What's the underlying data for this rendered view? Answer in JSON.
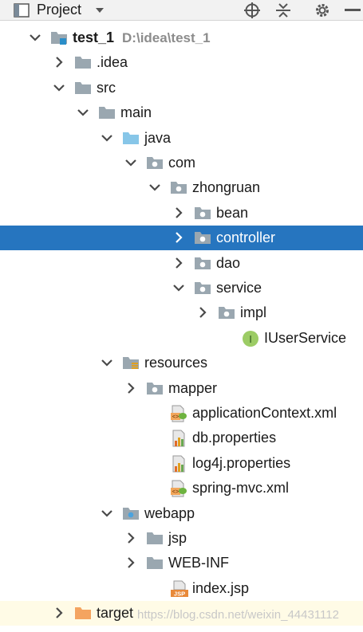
{
  "toolbar": {
    "title": "Project",
    "icons": [
      "project-view-icon",
      "chevron-down-icon",
      "locate-icon",
      "collapse-all-icon",
      "gear-icon",
      "hide-icon"
    ]
  },
  "tree": [
    {
      "id": "test_1",
      "label": "test_1",
      "hint": "D:\\idea\\test_1",
      "level": 0,
      "expanded": true,
      "icon": "module",
      "bold": true
    },
    {
      "id": "idea",
      "label": ".idea",
      "level": 1,
      "expanded": false,
      "icon": "folder"
    },
    {
      "id": "src",
      "label": "src",
      "level": 1,
      "expanded": true,
      "icon": "folder"
    },
    {
      "id": "main",
      "label": "main",
      "level": 2,
      "expanded": true,
      "icon": "folder"
    },
    {
      "id": "java",
      "label": "java",
      "level": 3,
      "expanded": true,
      "icon": "source-root"
    },
    {
      "id": "com",
      "label": "com",
      "level": 4,
      "expanded": true,
      "icon": "package"
    },
    {
      "id": "zhongruan",
      "label": "zhongruan",
      "level": 5,
      "expanded": true,
      "icon": "package"
    },
    {
      "id": "bean",
      "label": "bean",
      "level": 6,
      "expanded": false,
      "icon": "package"
    },
    {
      "id": "controller",
      "label": "controller",
      "level": 6,
      "expanded": false,
      "icon": "package",
      "selected": true
    },
    {
      "id": "dao",
      "label": "dao",
      "level": 6,
      "expanded": false,
      "icon": "package"
    },
    {
      "id": "service",
      "label": "service",
      "level": 6,
      "expanded": true,
      "icon": "package"
    },
    {
      "id": "impl",
      "label": "impl",
      "level": 7,
      "expanded": false,
      "icon": "package"
    },
    {
      "id": "IUserService",
      "label": "IUserService",
      "level": 8,
      "icon": "interface"
    },
    {
      "id": "resources",
      "label": "resources",
      "level": 3,
      "expanded": true,
      "icon": "resources-root"
    },
    {
      "id": "mapper",
      "label": "mapper",
      "level": 4,
      "expanded": false,
      "icon": "package"
    },
    {
      "id": "applicationContext",
      "label": "applicationContext.xml",
      "level": 5,
      "icon": "spring-xml"
    },
    {
      "id": "db-properties",
      "label": "db.properties",
      "level": 5,
      "icon": "properties"
    },
    {
      "id": "log4j-properties",
      "label": "log4j.properties",
      "level": 5,
      "icon": "properties"
    },
    {
      "id": "spring-mvc",
      "label": "spring-mvc.xml",
      "level": 5,
      "icon": "spring-xml"
    },
    {
      "id": "webapp",
      "label": "webapp",
      "level": 3,
      "expanded": true,
      "icon": "web-root"
    },
    {
      "id": "jsp",
      "label": "jsp",
      "level": 4,
      "expanded": false,
      "icon": "folder"
    },
    {
      "id": "web-inf",
      "label": "WEB-INF",
      "level": 4,
      "expanded": false,
      "icon": "folder"
    },
    {
      "id": "index-jsp",
      "label": "index.jsp",
      "level": 5,
      "icon": "jsp"
    },
    {
      "id": "target",
      "label": "target",
      "level": 1,
      "expanded": false,
      "icon": "excluded-folder",
      "bottom": true
    }
  ],
  "watermark": "https://blog.csdn.net/weixin_44431112",
  "colors": {
    "selection": "#2675bf",
    "folder": "#9aa7b0",
    "source_root": "#87c6e8",
    "excluded": "#f4a460",
    "interface_badge": "#9ccc65"
  }
}
